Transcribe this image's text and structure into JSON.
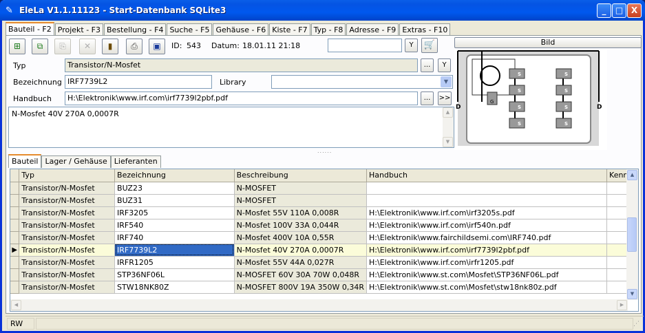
{
  "window": {
    "title": "EleLa V1.1.11123  - Start-Datenbank SQLite3",
    "app_icon": "pencil-icon",
    "controls": {
      "minimize": "_",
      "maximize": "□",
      "close": "X"
    }
  },
  "main_tabs": [
    "Bauteil - F2",
    "Projekt - F3",
    "Bestellung - F4",
    "Suche - F5",
    "Gehäuse - F6",
    "Kiste - F7",
    "Typ - F8",
    "Adresse - F9",
    "Extras - F10"
  ],
  "toolbar": {
    "icons": [
      "new-part-icon",
      "copy-part-icon",
      "paste-part-icon",
      "delete-icon",
      "book-icon",
      "print-icon",
      "save-icon"
    ],
    "id_label": "ID:",
    "id_value": "543",
    "date_label": "Datum:",
    "date_value": "18.01.11 21:18",
    "search_value": "",
    "y_label": "Y",
    "cart_icon": "cart-icon"
  },
  "form": {
    "typ_label": "Typ",
    "typ_value": "Transistor/N-Mosfet",
    "typ_more": "...",
    "typ_y": "Y",
    "bezeichnung_label": "Bezeichnung",
    "bezeichnung_value": "IRF7739L2",
    "library_label": "Library",
    "library_value": "",
    "handbuch_label": "Handbuch",
    "handbuch_value": "H:\\Elektronik\\www.irf.com\\irf7739l2pbf.pdf",
    "handbuch_more": "...",
    "handbuch_open": ">>",
    "notes": "N-Mosfet 40V 270A 0,0007R"
  },
  "bild_button": "Bild",
  "image_pins": {
    "pin_d": "D",
    "pin_g": "G",
    "pin_s": "S"
  },
  "sub_tabs": [
    "Bauteil",
    "Lager / Gehäuse",
    "Lieferanten"
  ],
  "grid": {
    "columns": [
      "Typ",
      "Bezeichnung",
      "Beschreibung",
      "Handbuch",
      "Kennz"
    ],
    "rows": [
      {
        "typ": "Transistor/N-Mosfet",
        "bez": "BUZ23",
        "besch": "N-MOSFET",
        "hb": ""
      },
      {
        "typ": "Transistor/N-Mosfet",
        "bez": "BUZ31",
        "besch": "N-MOSFET",
        "hb": ""
      },
      {
        "typ": "Transistor/N-Mosfet",
        "bez": "IRF3205",
        "besch": "N-Mosfet 55V 110A 0,008R",
        "hb": "H:\\Elektronik\\www.irf.com\\irf3205s.pdf"
      },
      {
        "typ": "Transistor/N-Mosfet",
        "bez": "IRF540",
        "besch": "N-Mosfet 100V 33A 0,044R",
        "hb": "H:\\Elektronik\\www.irf.com\\irf540n.pdf"
      },
      {
        "typ": "Transistor/N-Mosfet",
        "bez": "IRF740",
        "besch": "N-Mosfet 400V 10A 0,55R",
        "hb": "H:\\Elektronik\\www.fairchildsemi.com\\IRF740.pdf"
      },
      {
        "typ": "Transistor/N-Mosfet",
        "bez": "IRF7739L2",
        "besch": "N-Mosfet 40V 270A 0,0007R",
        "hb": "H:\\Elektronik\\www.irf.com\\irf7739l2pbf.pdf",
        "selected": true
      },
      {
        "typ": "Transistor/N-Mosfet",
        "bez": "IRFR1205",
        "besch": "N-Mosfet 55V 44A 0,027R",
        "hb": "H:\\Elektronik\\www.irf.com\\irfr1205.pdf"
      },
      {
        "typ": "Transistor/N-Mosfet",
        "bez": "STP36NF06L",
        "besch": "N-MOSFET 60V 30A 70W 0,048R",
        "hb": "H:\\Elektronik\\www.st.com\\Mosfet\\STP36NF06L.pdf"
      },
      {
        "typ": "Transistor/N-Mosfet",
        "bez": "STW18NK80Z",
        "besch": "N-MOSFET 800V 19A 350W 0,34R",
        "hb": "H:\\Elektronik\\www.st.com\\Mosfet\\stw18nk80z.pdf"
      }
    ]
  },
  "status": {
    "mode": "RW"
  }
}
